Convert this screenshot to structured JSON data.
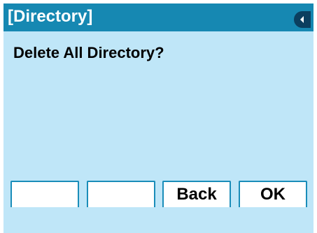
{
  "header": {
    "title": "[Directory]",
    "back_icon": "left-arrow-icon"
  },
  "main": {
    "message": "Delete All Directory?"
  },
  "softkeys": [
    {
      "label": ""
    },
    {
      "label": ""
    },
    {
      "label": "Back"
    },
    {
      "label": "OK"
    }
  ],
  "colors": {
    "title_bar": "#1688b2",
    "background": "#bfe6f8",
    "softkey_border": "#1a8db9",
    "back_button": "#0b3f5f"
  }
}
